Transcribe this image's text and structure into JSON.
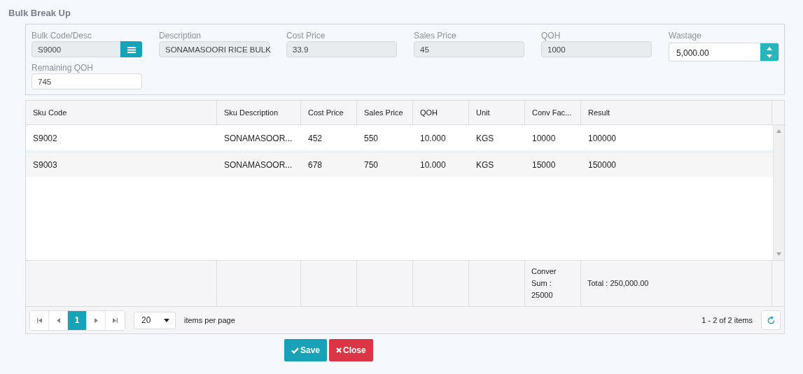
{
  "title": "Bulk Break Up",
  "form": {
    "fields": [
      {
        "kind": "lookup",
        "label": "Bulk Code/Desc",
        "value": "S9000"
      },
      {
        "kind": "readonly",
        "label": "Description",
        "value": "SONAMASOORI RICE BULK"
      },
      {
        "kind": "readonly",
        "label": "Cost Price",
        "value": "33.9"
      },
      {
        "kind": "readonly",
        "label": "Sales Price",
        "value": "45"
      },
      {
        "kind": "readonly",
        "label": "QOH",
        "value": "1000"
      },
      {
        "kind": "spinner",
        "label": "Wastage",
        "value": "5,000.00"
      },
      {
        "kind": "text",
        "label": "Remaining QOH",
        "value": "745"
      }
    ]
  },
  "table": {
    "columns": [
      "Sku Code",
      "Sku Description",
      "Cost Price",
      "Sales Price",
      "QOH",
      "Unit",
      "Conv Fac...",
      "Result"
    ],
    "rows": [
      [
        "S9002",
        "SONAMASOOR...",
        "452",
        "550",
        "10.000",
        "KGS",
        "10000",
        "100000"
      ],
      [
        "S9003",
        "SONAMASOOR...",
        "678",
        "750",
        "10.000",
        "KGS",
        "15000",
        "150000"
      ]
    ],
    "footer": [
      "Conver Sum : 25000",
      "Total : 250,000.00"
    ]
  },
  "pager": {
    "pages": [
      {
        "label": "1",
        "selected": true
      }
    ],
    "page_size": "20",
    "page_size_label": "items per page",
    "info": "1 - 2 of 2 items"
  },
  "buttons": [
    {
      "kind": "save",
      "label": "Save"
    },
    {
      "kind": "close",
      "label": "Close"
    }
  ]
}
